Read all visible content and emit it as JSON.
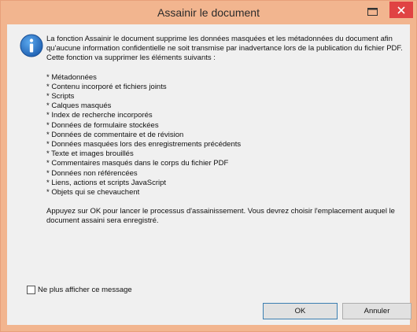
{
  "window": {
    "title": "Assainir le document"
  },
  "message": {
    "intro": "La fonction Assainir le document supprime les données masquées et les métadonnées du document afin qu'aucune information confidentielle ne soit transmise par inadvertance lors de la publication du fichier PDF. Cette fonction va supprimer les éléments suivants :",
    "items": [
      "* Métadonnées",
      "* Contenu incorporé et fichiers joints",
      "* Scripts",
      "* Calques masqués",
      "* Index de recherche incorporés",
      "* Données de formulaire stockées",
      "* Données de commentaire et de révision",
      "* Données masquées lors des enregistrements précédents",
      "* Texte et images brouillés",
      "* Commentaires masqués dans le corps du fichier PDF",
      "* Données non référencées",
      "* Liens, actions et scripts JavaScript",
      "* Objets qui se chevauchent"
    ],
    "outro": "Appuyez sur OK pour lancer le processus d'assainissement. Vous devrez choisir l'emplacement auquel le document assaini sera enregistré."
  },
  "checkbox": {
    "label": "Ne plus afficher ce message",
    "checked": false
  },
  "buttons": {
    "ok": "OK",
    "cancel": "Annuler"
  },
  "colors": {
    "titlebar": "#f2b58f",
    "close": "#e04343",
    "info": "#1e6fc0"
  }
}
